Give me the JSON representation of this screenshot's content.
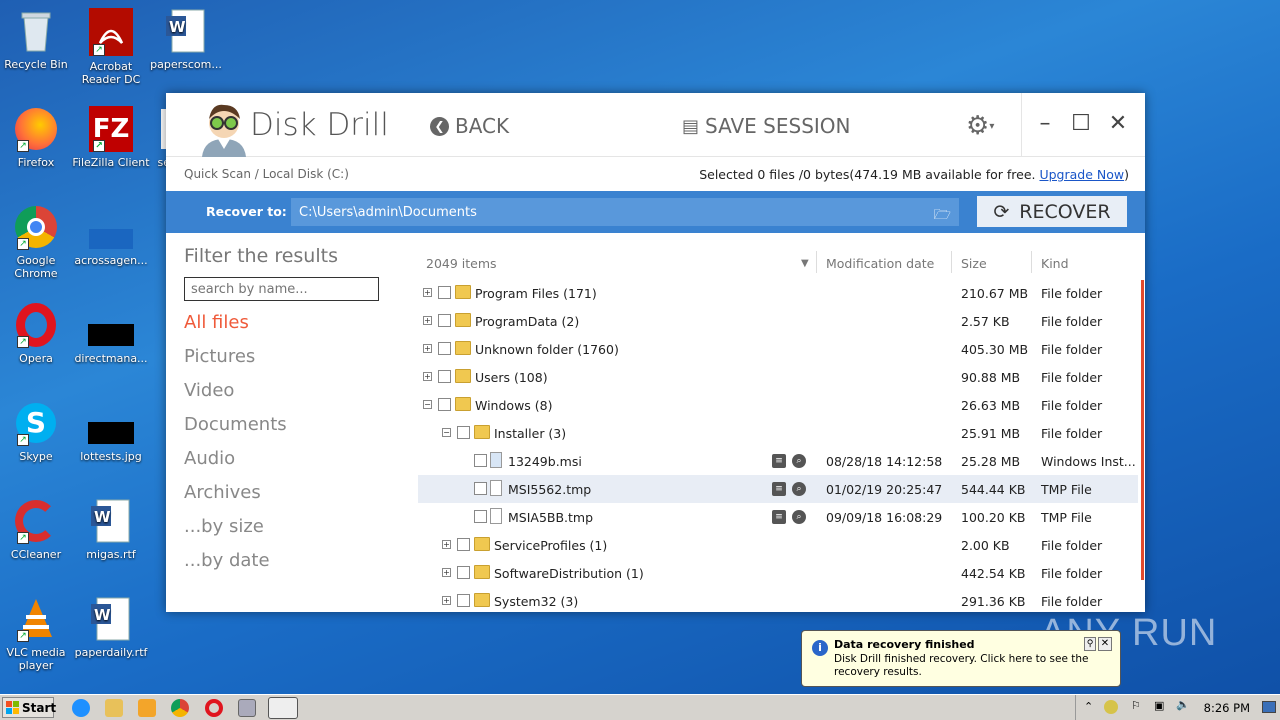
{
  "desktop": {
    "icons": [
      {
        "label": "Recycle Bin"
      },
      {
        "label": "Acrobat Reader DC"
      },
      {
        "label": "paperscom..."
      },
      {
        "label": "Firefox"
      },
      {
        "label": "FileZilla Client"
      },
      {
        "label": "se"
      },
      {
        "label": "Google Chrome"
      },
      {
        "label": "acrossagen..."
      },
      {
        "label": "Opera"
      },
      {
        "label": "directmana..."
      },
      {
        "label": "Skype"
      },
      {
        "label": "lottests.jpg"
      },
      {
        "label": "CCleaner"
      },
      {
        "label": "migas.rtf"
      },
      {
        "label": "VLC media player"
      },
      {
        "label": "paperdaily.rtf"
      }
    ]
  },
  "app": {
    "title": "Disk Drill",
    "back_label": "BACK",
    "save_label": "SAVE SESSION",
    "breadcrumb": "Quick Scan / Local Disk (C:)",
    "selection_text": "Selected 0 files /0 bytes(474.19 MB available for free.",
    "upgrade_link": "Upgrade Now",
    "selection_close": ")",
    "recover_to_label": "Recover to:",
    "recover_path": "C:\\Users\\admin\\Documents",
    "recover_button": "RECOVER"
  },
  "sidebar": {
    "filter_title": "Filter the results",
    "search_placeholder": "search by name...",
    "categories": [
      "All files",
      "Pictures",
      "Video",
      "Documents",
      "Audio",
      "Archives",
      "...by size",
      "...by date"
    ]
  },
  "list": {
    "item_count": "2049 items",
    "columns": {
      "date": "Modification date",
      "size": "Size",
      "kind": "Kind"
    },
    "rows": [
      {
        "name": "Program Files (171)",
        "date": "",
        "size": "210.67 MB",
        "kind": "File folder"
      },
      {
        "name": "ProgramData (2)",
        "date": "",
        "size": "2.57 KB",
        "kind": "File folder"
      },
      {
        "name": "Unknown folder (1760)",
        "date": "",
        "size": "405.30 MB",
        "kind": "File folder"
      },
      {
        "name": "Users (108)",
        "date": "",
        "size": "90.88 MB",
        "kind": "File folder"
      },
      {
        "name": "Windows (8)",
        "date": "",
        "size": "26.63 MB",
        "kind": "File folder"
      },
      {
        "name": "Installer (3)",
        "date": "",
        "size": "25.91 MB",
        "kind": "File folder"
      },
      {
        "name": "13249b.msi",
        "date": "08/28/18 14:12:58",
        "size": "25.28 MB",
        "kind": "Windows Inst..."
      },
      {
        "name": "MSI5562.tmp",
        "date": "01/02/19 20:25:47",
        "size": "544.44 KB",
        "kind": "TMP File"
      },
      {
        "name": "MSIA5BB.tmp",
        "date": "09/09/18 16:08:29",
        "size": "100.20 KB",
        "kind": "TMP File"
      },
      {
        "name": "ServiceProfiles (1)",
        "date": "",
        "size": "2.00 KB",
        "kind": "File folder"
      },
      {
        "name": "SoftwareDistribution (1)",
        "date": "",
        "size": "442.54 KB",
        "kind": "File folder"
      },
      {
        "name": "System32 (3)",
        "date": "",
        "size": "291.36 KB",
        "kind": "File folder"
      }
    ]
  },
  "notification": {
    "title": "Data recovery finished",
    "body": "Disk Drill finished recovery. Click here to see the recovery results."
  },
  "watermark": "ANY RUN",
  "taskbar": {
    "start_label": "Start",
    "clock": "8:26 PM"
  },
  "colors": {
    "accent": "#3a82d0",
    "active_category": "#ef5a3a",
    "desktop": "#1f6dc6"
  }
}
